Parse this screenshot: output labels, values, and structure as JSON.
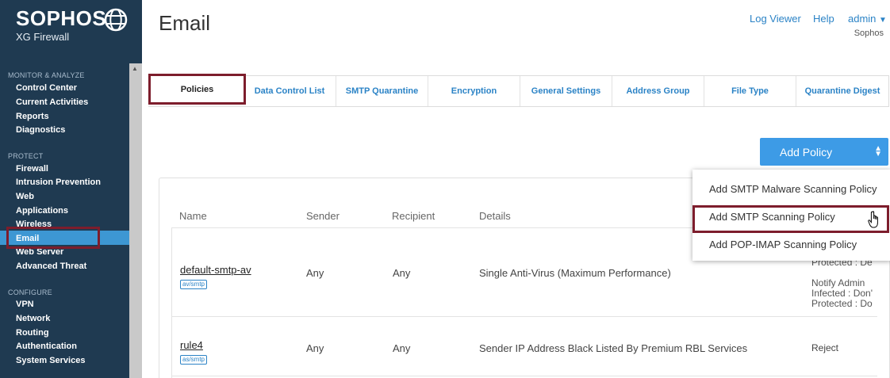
{
  "brand": {
    "name": "SOPHOS",
    "product": "XG Firewall"
  },
  "sidebar": {
    "sections": [
      {
        "title": "MONITOR & ANALYZE",
        "items": [
          "Control Center",
          "Current Activities",
          "Reports",
          "Diagnostics"
        ]
      },
      {
        "title": "PROTECT",
        "items": [
          "Firewall",
          "Intrusion Prevention",
          "Web",
          "Applications",
          "Wireless",
          "Email",
          "Web Server",
          "Advanced Threat"
        ]
      },
      {
        "title": "CONFIGURE",
        "items": [
          "VPN",
          "Network",
          "Routing",
          "Authentication",
          "System Services"
        ]
      }
    ],
    "active_item": "Email"
  },
  "header": {
    "title": "Email",
    "log_viewer": "Log Viewer",
    "help": "Help",
    "user": "admin",
    "tenant": "Sophos"
  },
  "tabs": [
    "Policies",
    "Data Control List",
    "SMTP Quarantine",
    "Encryption",
    "General Settings",
    "Address Group",
    "File Type",
    "Quarantine Digest"
  ],
  "active_tab": "Policies",
  "add_policy": {
    "label": "Add Policy",
    "options": [
      "Add SMTP Malware Scanning Policy",
      "Add SMTP Scanning Policy",
      "Add POP-IMAP Scanning Policy"
    ],
    "hovered": "Add SMTP Scanning Policy"
  },
  "table": {
    "columns": [
      "Name",
      "Sender",
      "Recipient",
      "Details"
    ],
    "rows": [
      {
        "name": "default-smtp-av",
        "tag": "av/smtp",
        "sender": "Any",
        "recipient": "Any",
        "details": "Single Anti-Virus (Maximum Performance)",
        "action_top": "Protected : De",
        "action_bottom": "Notify Admin\nInfected : Don'\nProtected : Do"
      },
      {
        "name": "rule4",
        "tag": "as/smtp",
        "sender": "Any",
        "recipient": "Any",
        "details": "Sender IP Address Black Listed By Premium RBL Services",
        "action": "Reject"
      }
    ]
  },
  "colors": {
    "sidebar": "#1f3a51",
    "accent": "#3d97d3",
    "highlight": "#7d1d2c",
    "link": "#2b83c6"
  },
  "icons": [
    "globe-logo-icon",
    "chevron-down-icon",
    "scroll-up-icon",
    "updown-arrows-icon",
    "hand-cursor-icon"
  ]
}
